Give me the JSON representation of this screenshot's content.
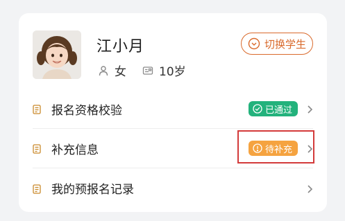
{
  "student": {
    "name": "江小月",
    "gender": "女",
    "age": "10岁",
    "switch_label": "切换学生"
  },
  "items": [
    {
      "label": "报名资格校验",
      "status": "已通过",
      "status_color": "#23b27c"
    },
    {
      "label": "补充信息",
      "status": "待补充",
      "status_color": "#f5a340"
    },
    {
      "label": "我的预报名记录",
      "status": null
    }
  ],
  "colors": {
    "accent": "#d9692b",
    "icon_gold": "#c9892a",
    "highlight": "#d33a3a"
  },
  "icons": {
    "person": "person-outline-icon",
    "id_card": "id-card-icon",
    "switch": "swap-circle-icon",
    "doc": "document-icon",
    "check": "check-circle-icon",
    "alert": "exclamation-circle-icon",
    "chevron": "chevron-right-icon"
  }
}
